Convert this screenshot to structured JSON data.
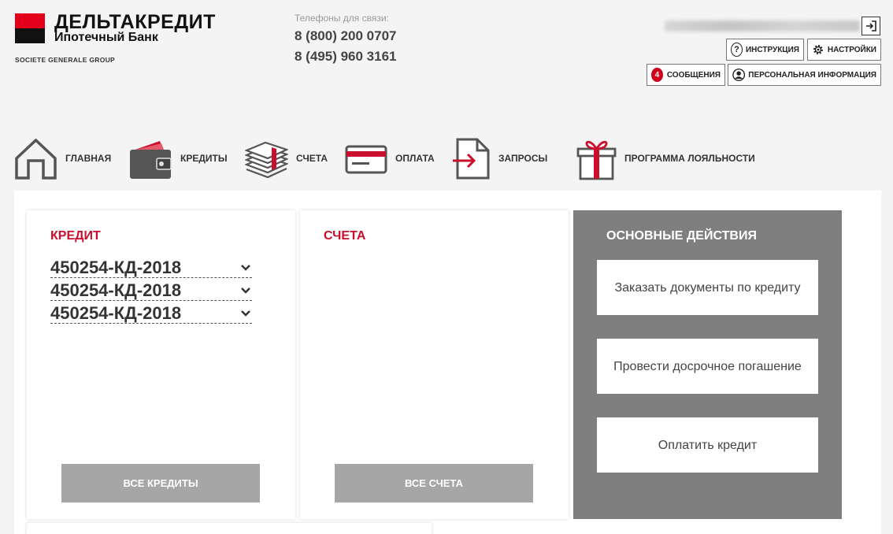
{
  "brand": {
    "name": "ДЕЛЬТАКРЕДИТ",
    "subtitle": "Ипотечный Банк",
    "group": "SOCIETE GENERALE GROUP",
    "colors": {
      "red": "#e2001a",
      "black": "#111111"
    }
  },
  "contacts": {
    "label": "Телефоны для связи:",
    "phones": [
      "8 (800) 200 0707",
      "8 (495) 960 3161"
    ]
  },
  "user": {
    "name": "████████ ██████ ███████████",
    "logout_icon": "logout-icon"
  },
  "header_buttons": {
    "instructions": "ИНСТРУКЦИЯ",
    "settings": "НАСТРОЙКИ",
    "messages": "СООБЩЕНИЯ",
    "messages_count": "4",
    "personal": "ПЕРСОНАЛЬНАЯ ИНФОРМАЦИЯ"
  },
  "nav": [
    {
      "label": "ГЛАВНАЯ",
      "icon": "home-icon"
    },
    {
      "label": "КРЕДИТЫ",
      "icon": "wallet-icon"
    },
    {
      "label": "СЧЕТА",
      "icon": "money-stack-icon"
    },
    {
      "label": "ОПЛАТА",
      "icon": "card-icon"
    },
    {
      "label": "ЗАПРОСЫ",
      "icon": "request-icon"
    },
    {
      "label": "ПРОГРАММА ЛОЯЛЬНОСТИ",
      "icon": "gift-icon"
    }
  ],
  "credit_card": {
    "title": "КРЕДИТ",
    "loans": [
      "450254-КД-2018",
      "450254-КД-2018",
      "450254-КД-2018"
    ],
    "button": "ВСЕ КРЕДИТЫ"
  },
  "accounts_card": {
    "title": "СЧЕТА",
    "button": "ВСЕ СЧЕТА"
  },
  "actions": {
    "title": "ОСНОВНЫЕ ДЕЙСТВИЯ",
    "buttons": [
      "Заказать документы по кредиту",
      "Провести досрочное погашение",
      "Оплатить кредит"
    ]
  },
  "colors": {
    "accent": "#c8102e",
    "panel_grey": "#7f7f7f",
    "button_grey": "#a6a6a6"
  }
}
